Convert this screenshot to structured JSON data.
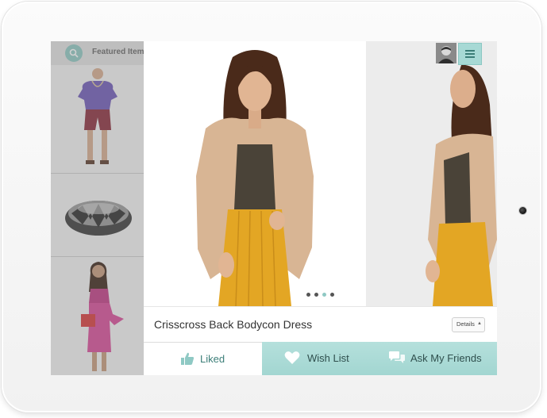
{
  "sidebar": {
    "header_label": "Featured Items",
    "icon": "search-icon"
  },
  "product": {
    "title": "Crisscross Back Bodycon Dress",
    "details_label": "Details",
    "image_count": 4,
    "active_image": 3
  },
  "actions": {
    "liked_label": "Liked",
    "wishlist_label": "Wish List",
    "ask_label": "Ask My Friends"
  },
  "colors": {
    "accent": "#a2d6d1",
    "accent_dark": "#3d7f79"
  }
}
